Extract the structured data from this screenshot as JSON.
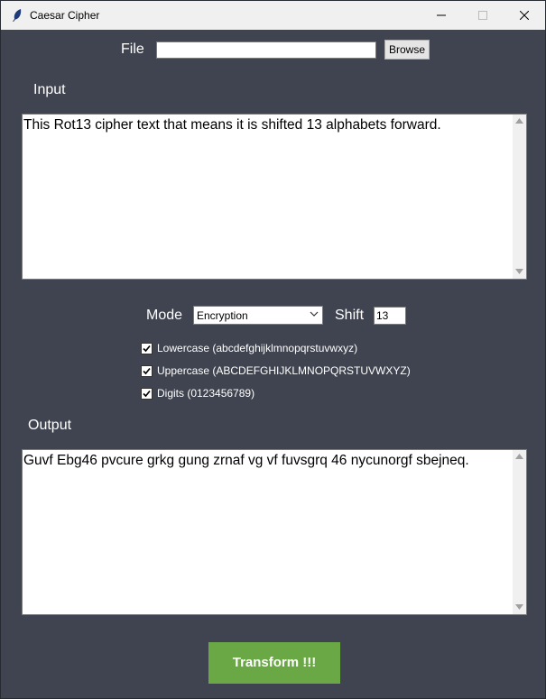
{
  "window": {
    "title": "Caesar Cipher"
  },
  "file": {
    "label": "File",
    "value": "",
    "browse_label": "Browse"
  },
  "input": {
    "label": "Input",
    "text": "This Rot13 cipher text that means it is shifted 13 alphabets forward."
  },
  "mode": {
    "label": "Mode",
    "selected": "Encryption"
  },
  "shift": {
    "label": "Shift",
    "value": "13"
  },
  "options": [
    {
      "label": "Lowercase (abcdefghijklmnopqrstuvwxyz)",
      "checked": true
    },
    {
      "label": "Uppercase (ABCDEFGHIJKLMNOPQRSTUVWXYZ)",
      "checked": true
    },
    {
      "label": "Digits (0123456789)",
      "checked": true
    }
  ],
  "output": {
    "label": "Output",
    "text": "Guvf Ebg46 pvcure grkg gung zrnaf vg vf fuvsgrq 46 nycunorgf sbejneq."
  },
  "actions": {
    "transform_label": "Transform !!!"
  },
  "colors": {
    "background": "#3f4450",
    "button": "#6aa745"
  },
  "icons": {
    "app": "feather-icon",
    "minimize": "minimize-icon",
    "maximize": "maximize-icon",
    "close": "close-icon"
  }
}
